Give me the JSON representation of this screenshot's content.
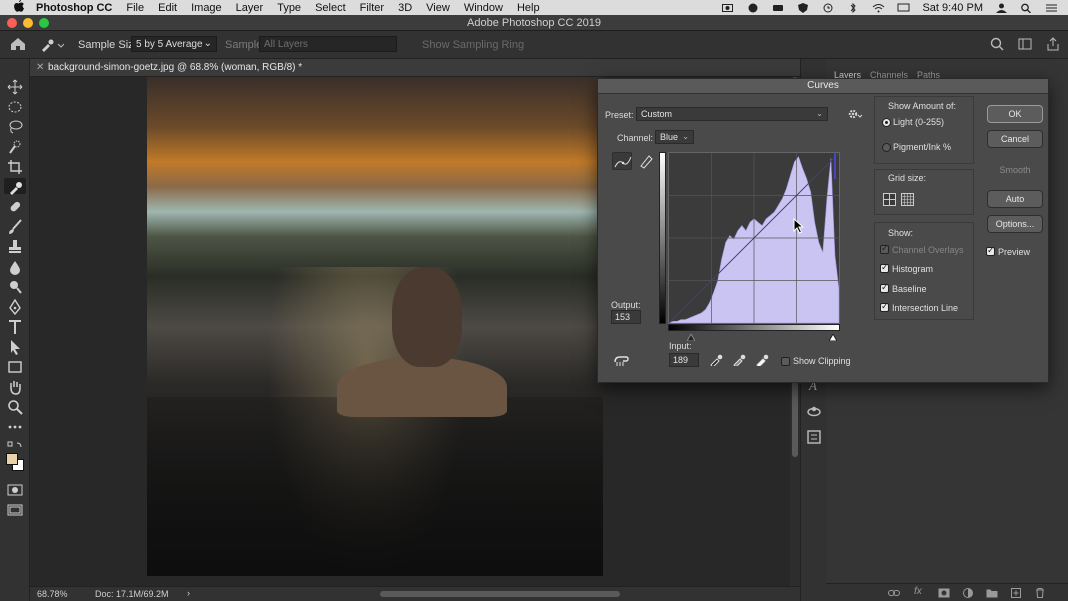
{
  "menubar": {
    "app_name": "Photoshop CC",
    "items": [
      "File",
      "Edit",
      "Image",
      "Layer",
      "Type",
      "Select",
      "Filter",
      "3D",
      "View",
      "Window",
      "Help"
    ],
    "clock": "Sat 9:40 PM"
  },
  "window": {
    "title": "Adobe Photoshop CC 2019"
  },
  "options_bar": {
    "sample_size_label": "Sample Size:",
    "sample_size_value": "5 by 5 Average",
    "sample_label": "Sample:",
    "sample_value": "All Layers",
    "show_ring": "Show Sampling Ring"
  },
  "document": {
    "tab_name": "background-simon-goetz.jpg @ 68.8% (woman, RGB/8) *",
    "zoom": "68.78%",
    "doc_size": "Doc: 17.1M/69.2M"
  },
  "panels": {
    "tabs": [
      "Layers",
      "Channels",
      "Paths"
    ]
  },
  "curves": {
    "title": "Curves",
    "preset_label": "Preset:",
    "preset_value": "Custom",
    "channel_label": "Channel:",
    "channel_value": "Blue",
    "output_label": "Output:",
    "output_value": "153",
    "input_label": "Input:",
    "input_value": "189",
    "show_clipping": "Show Clipping",
    "show_amount_title": "Show Amount of:",
    "light_label": "Light  (0-255)",
    "pigment_label": "Pigment/Ink %",
    "grid_size_title": "Grid size:",
    "show_title": "Show:",
    "show_options": [
      {
        "label": "Channel Overlays",
        "checked": true,
        "disabled": true
      },
      {
        "label": "Histogram",
        "checked": true,
        "disabled": false
      },
      {
        "label": "Baseline",
        "checked": true,
        "disabled": false
      },
      {
        "label": "Intersection Line",
        "checked": true,
        "disabled": false
      }
    ],
    "buttons": {
      "ok": "OK",
      "cancel": "Cancel",
      "smooth": "Smooth",
      "auto": "Auto",
      "options": "Options..."
    },
    "preview_label": "Preview",
    "histogram_color": "#c9c4f2"
  }
}
